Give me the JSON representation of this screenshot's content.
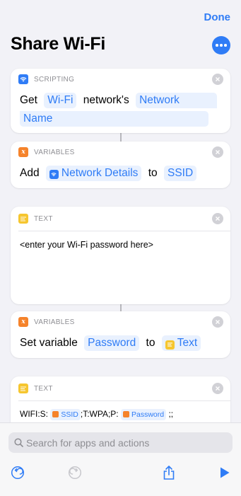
{
  "nav": {
    "done_label": "Done",
    "title": "Share Wi-Fi"
  },
  "actions": [
    {
      "category": "SCRIPTING",
      "parts": [
        "Get",
        "Wi-Fi",
        "network's",
        "Network",
        "Name"
      ]
    },
    {
      "category": "VARIABLES",
      "parts": [
        "Add",
        "Network Details",
        "to",
        "SSID"
      ]
    },
    {
      "category": "TEXT",
      "text": "<enter your Wi-Fi password here>"
    },
    {
      "category": "VARIABLES",
      "parts": [
        "Set variable",
        "Password",
        "to",
        "Text"
      ]
    },
    {
      "category": "TEXT",
      "parts": [
        "WIFI:S:",
        "SSID",
        ";T:WPA;P:",
        "Password",
        ";;"
      ]
    }
  ],
  "search": {
    "placeholder": "Search for apps and actions"
  },
  "colors": {
    "accent": "#2f7cf6",
    "scripting": "#2f7cf6",
    "variables": "#f5832b",
    "text": "#f6c62f"
  }
}
